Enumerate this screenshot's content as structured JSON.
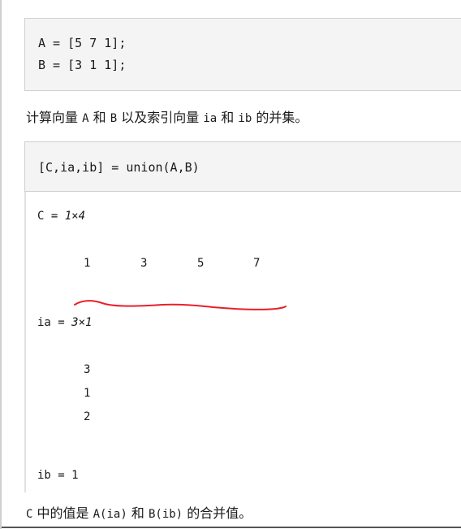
{
  "code_block_1": {
    "line_1": "A = [5 7 1];",
    "line_2": "B = [3 1 1];"
  },
  "paragraph_1": {
    "text_1": "计算向量 ",
    "var_a": "A",
    "text_2": " 和 ",
    "var_b": "B",
    "text_3": " 以及索引向量 ",
    "var_ia": "ia",
    "text_4": " 和 ",
    "var_ib": "ib",
    "text_5": " 的并集。"
  },
  "code_block_2": {
    "line_1": "[C,ia,ib] = union(A,B)"
  },
  "output": {
    "c_label": "C = ",
    "c_size": "1×4",
    "c_values": [
      "1",
      "3",
      "5",
      "7"
    ],
    "ia_label": "ia = ",
    "ia_size": "3×1",
    "ia_values": [
      "3",
      "1",
      "2"
    ],
    "ib_line": "ib = 1"
  },
  "paragraph_2": {
    "var_c": "C",
    "text_1": " 中的值是 ",
    "expr_1": "A(ia)",
    "text_2": " 和 ",
    "expr_2": "B(ib)",
    "text_3": " 的合并值。"
  },
  "annotation": {
    "color": "#e8202a"
  }
}
